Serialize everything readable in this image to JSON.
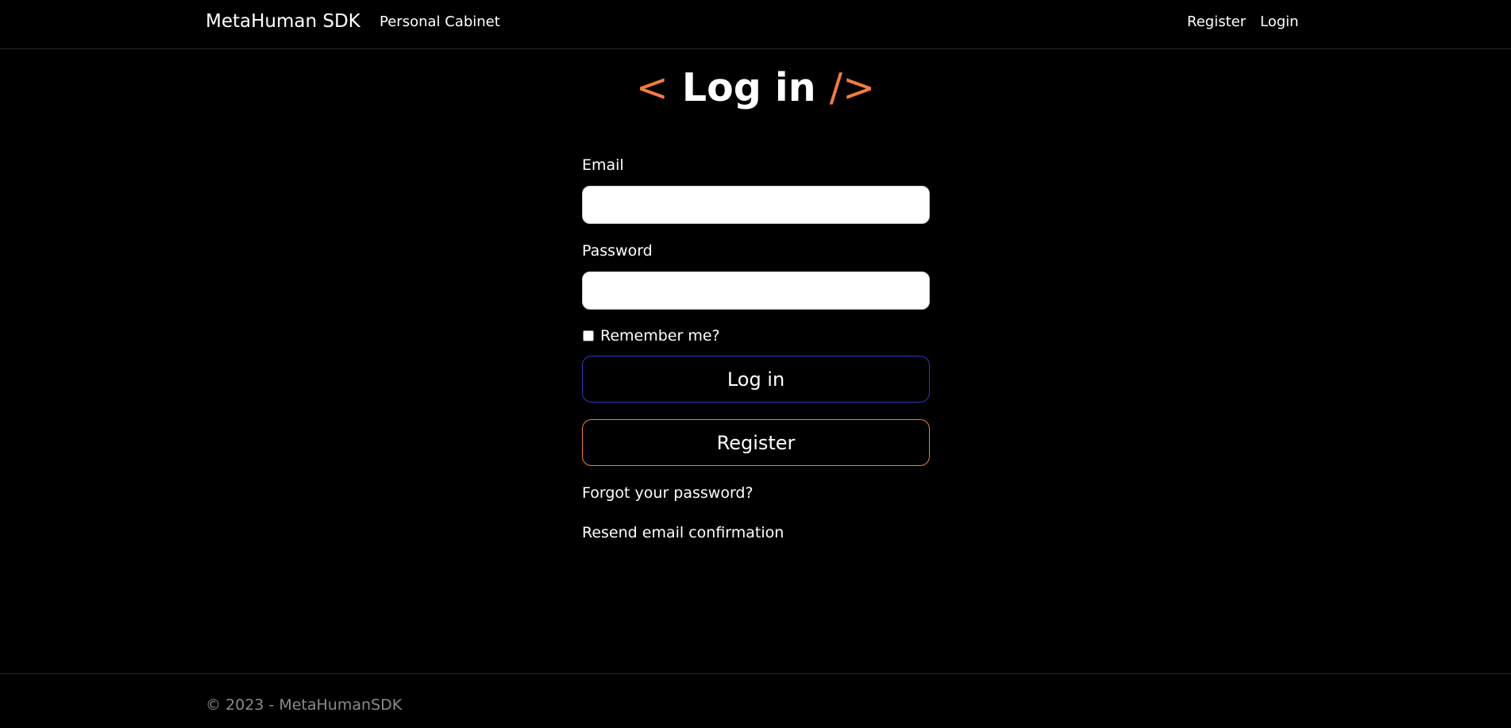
{
  "header": {
    "brand": "MetaHuman SDK",
    "nav_left": [
      "Personal Cabinet"
    ],
    "nav_right": [
      "Register",
      "Login"
    ]
  },
  "title": {
    "prefix": "<",
    "text": "Log in",
    "suffix": "/>"
  },
  "form": {
    "email_label": "Email",
    "email_value": "",
    "password_label": "Password",
    "password_value": "",
    "remember_label": "Remember me?",
    "remember_checked": false,
    "login_button": "Log in",
    "register_button": "Register",
    "forgot_link": "Forgot your password?",
    "resend_link": "Resend email confirmation"
  },
  "footer": {
    "text": "© 2023 - MetaHumanSDK"
  },
  "colors": {
    "background": "#000000",
    "accent_orange": "#f47c3c",
    "accent_blue": "#2e35c9",
    "footer_text": "#8a8a8a"
  }
}
